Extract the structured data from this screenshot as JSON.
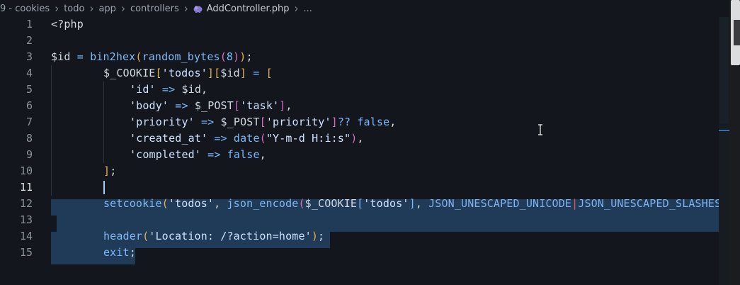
{
  "breadcrumb": {
    "items": [
      "9 - cookies",
      "todo",
      "app",
      "controllers"
    ],
    "file": "AddController.php",
    "ellipsis": "...",
    "separator": "›"
  },
  "editor": {
    "active_line": 11,
    "lines": [
      {
        "n": "1"
      },
      {
        "n": "2"
      },
      {
        "n": "3"
      },
      {
        "n": "4"
      },
      {
        "n": "5"
      },
      {
        "n": "6"
      },
      {
        "n": "7"
      },
      {
        "n": "8"
      },
      {
        "n": "9"
      },
      {
        "n": "10"
      },
      {
        "n": "11"
      },
      {
        "n": "12"
      },
      {
        "n": "13"
      },
      {
        "n": "14"
      },
      {
        "n": "15"
      }
    ],
    "code": {
      "l1": {
        "open_tag": "<?php"
      },
      "l3": {
        "var": "$id",
        "eq": " = ",
        "fn": "bin2hex",
        "p1": "(",
        "fn2": "random_bytes",
        "p2": "(",
        "num": "8",
        "p3": ")",
        "p4": ")",
        "semi": ";"
      },
      "l4": {
        "var": "$_COOKIE",
        "b1": "[",
        "key": "'todos'",
        "b2": "]",
        "b3": "[",
        "var2": "$id",
        "b4": "]",
        "eq": " = ",
        "b5": "["
      },
      "l5": {
        "key": "'id'",
        "arrow": " => ",
        "var": "$id",
        "comma": ","
      },
      "l6": {
        "key": "'body'",
        "arrow": " => ",
        "var": "$_POST",
        "b1": "[",
        "key2": "'task'",
        "b2": "]",
        "comma": ","
      },
      "l7": {
        "key": "'priority'",
        "arrow": " => ",
        "var": "$_POST",
        "b1": "[",
        "key2": "'priority'",
        "b2": "]",
        "coalesce": "?? ",
        "kw": "false",
        "comma": ","
      },
      "l8": {
        "key": "'created_at'",
        "arrow": " => ",
        "fn": "date",
        "p1": "(",
        "str": "\"Y-m-d H:i:s\"",
        "p2": ")",
        "comma": ","
      },
      "l9": {
        "key": "'completed'",
        "arrow": " => ",
        "kw": "false",
        "comma": ","
      },
      "l10": {
        "close": "]",
        "semi": ";"
      },
      "l12": {
        "fn": "setcookie",
        "p1": "(",
        "key": "'todos'",
        "comma": ", ",
        "fn2": "json_encode",
        "p2": "(",
        "var": "$_COOKIE",
        "b1": "[",
        "key2": "'todos'",
        "b2": "]",
        "comma2": ", ",
        "const1": "JSON_UNESCAPED_UNICODE",
        "pipe": "|",
        "const2": "JSON_UNESCAPED_SLASHES",
        "p3": ")"
      },
      "l14": {
        "fn": "header",
        "p1": "(",
        "str": "'Location: /?action=home'",
        "p2": ")",
        "semi": ";"
      },
      "l15": {
        "kw": "exit",
        "semi": ";"
      }
    }
  },
  "colors": {
    "background": "#13171d",
    "selection": "#264a6e",
    "keyword": "#79b8ff",
    "bracket_gold": "#e3b341",
    "bracket_magenta": "#d16fbf"
  },
  "icons": {
    "php_file": "php-elephant-icon",
    "mouse": "text-cursor-icon"
  }
}
